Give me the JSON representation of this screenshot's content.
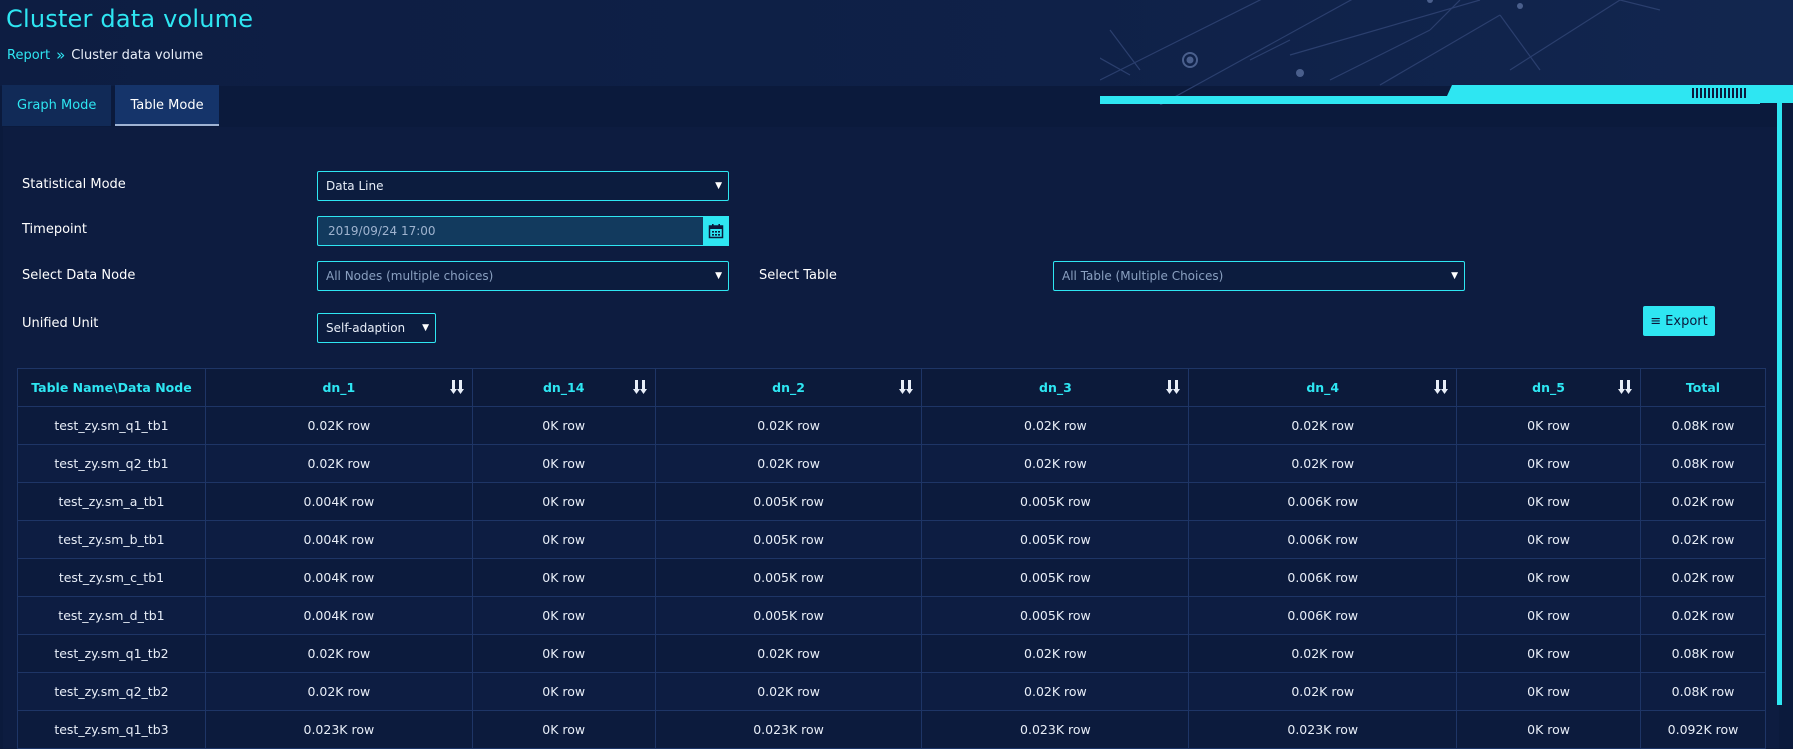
{
  "page": {
    "title": "Cluster data volume"
  },
  "breadcrumb": {
    "parent": "Report",
    "separator": "»",
    "current": "Cluster data volume"
  },
  "tabs": [
    {
      "label": "Graph Mode",
      "active": false
    },
    {
      "label": "Table Mode",
      "active": true
    }
  ],
  "form": {
    "statistical_mode": {
      "label": "Statistical Mode",
      "value": "Data Line"
    },
    "timepoint": {
      "label": "Timepoint",
      "value": "2019/09/24 17:00"
    },
    "data_node": {
      "label": "Select Data Node",
      "placeholder": "All Nodes (multiple choices)"
    },
    "table": {
      "label": "Select Table",
      "placeholder": "All Table (Multiple Choices)"
    },
    "unified_unit": {
      "label": "Unified Unit",
      "value": "Self-adaption"
    }
  },
  "export": {
    "label": "Export"
  },
  "colors": {
    "accent": "#2ee6f2",
    "background": "#0b1a3c",
    "panel": "#0d1c40",
    "tab": "#112a57"
  },
  "icons": {
    "calendar": "calendar-icon",
    "sort": "sort-icon",
    "export": "list-icon",
    "dropdown": "caret-down-icon"
  },
  "table": {
    "headers": [
      "Table Name\\Data Node",
      "dn_1",
      "dn_14",
      "dn_2",
      "dn_3",
      "dn_4",
      "dn_5",
      "Total"
    ],
    "rows": [
      [
        "test_zy.sm_q1_tb1",
        "0.02K row",
        "0K row",
        "0.02K row",
        "0.02K row",
        "0.02K row",
        "0K row",
        "0.08K row"
      ],
      [
        "test_zy.sm_q2_tb1",
        "0.02K row",
        "0K row",
        "0.02K row",
        "0.02K row",
        "0.02K row",
        "0K row",
        "0.08K row"
      ],
      [
        "test_zy.sm_a_tb1",
        "0.004K row",
        "0K row",
        "0.005K row",
        "0.005K row",
        "0.006K row",
        "0K row",
        "0.02K row"
      ],
      [
        "test_zy.sm_b_tb1",
        "0.004K row",
        "0K row",
        "0.005K row",
        "0.005K row",
        "0.006K row",
        "0K row",
        "0.02K row"
      ],
      [
        "test_zy.sm_c_tb1",
        "0.004K row",
        "0K row",
        "0.005K row",
        "0.005K row",
        "0.006K row",
        "0K row",
        "0.02K row"
      ],
      [
        "test_zy.sm_d_tb1",
        "0.004K row",
        "0K row",
        "0.005K row",
        "0.005K row",
        "0.006K row",
        "0K row",
        "0.02K row"
      ],
      [
        "test_zy.sm_q1_tb2",
        "0.02K row",
        "0K row",
        "0.02K row",
        "0.02K row",
        "0.02K row",
        "0K row",
        "0.08K row"
      ],
      [
        "test_zy.sm_q2_tb2",
        "0.02K row",
        "0K row",
        "0.02K row",
        "0.02K row",
        "0.02K row",
        "0K row",
        "0.08K row"
      ],
      [
        "test_zy.sm_q1_tb3",
        "0.023K row",
        "0K row",
        "0.023K row",
        "0.023K row",
        "0.023K row",
        "0K row",
        "0.092K row"
      ]
    ]
  }
}
